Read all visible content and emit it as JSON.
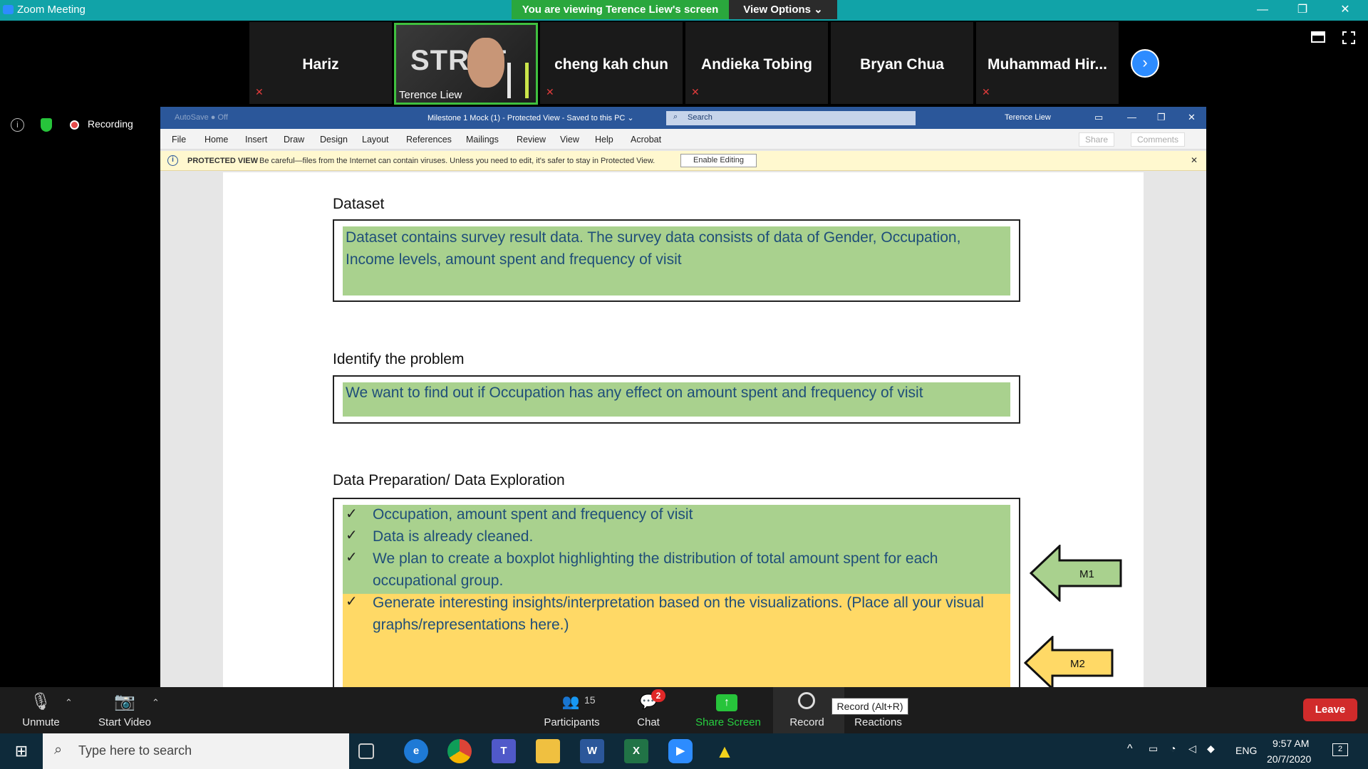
{
  "window": {
    "title": "Zoom Meeting"
  },
  "share_banner": {
    "viewing": "You are viewing Terence Liew's screen",
    "view_options": "View Options ⌄"
  },
  "window_buttons": {
    "minimize": "—",
    "restore": "❐",
    "close": "✕"
  },
  "gallery": {
    "participants": [
      {
        "name": "Hariz"
      },
      {
        "name": "Terence Liew",
        "video": true,
        "video_text": "STRAT"
      },
      {
        "name": "cheng kah chun"
      },
      {
        "name": "Andieka Tobing"
      },
      {
        "name": "Bryan Chua"
      },
      {
        "name": "Muhammad  Hir..."
      }
    ],
    "next_icon": "›",
    "muted_icon": "🎙"
  },
  "rail": {
    "info_icon": "i",
    "recording_label": "Recording"
  },
  "word": {
    "doc_title": "Milestone 1 Mock (1)  -  Protected View  -  Saved to this PC  ⌄",
    "quick_access": "AutoSave ● Off",
    "search_placeholder": "Search",
    "user": "Terence Liew",
    "tabs": [
      "File",
      "Home",
      "Insert",
      "Draw",
      "Design",
      "Layout",
      "References",
      "Mailings",
      "Review",
      "View",
      "Help",
      "Acrobat"
    ],
    "share_label": "Share",
    "comments_label": "Comments",
    "protected": {
      "label": "PROTECTED VIEW",
      "text": "Be careful—files from the Internet can contain viruses. Unless you need to edit, it's safer to stay in Protected View.",
      "button": "Enable Editing",
      "close": "✕"
    }
  },
  "document": {
    "dataset_heading": "Dataset",
    "dataset_text": "Dataset contains survey result data. The survey data consists of data of Gender, Occupation, Income levels, amount spent  and frequency of visit",
    "problem_heading": "Identify the problem",
    "problem_text": "We want to find out if Occupation has any effect on amount spent and frequency of visit",
    "prep_heading": "Data Preparation/ Data Exploration",
    "check_mark": "✓",
    "prep_items": [
      "Occupation, amount spent and frequency of visit",
      "Data is already cleaned.",
      "We plan to create a boxplot highlighting the distribution of total amount spent for each occupational group.",
      "Generate interesting insights/interpretation based on the visualizations. (Place all your visual graphs/representations here.)"
    ],
    "arrow_m1": "M1",
    "arrow_m2": "M2",
    "colors": {
      "green": "#a9d18e",
      "yellow": "#ffd966"
    }
  },
  "toolbar": {
    "unmute": "Unmute",
    "start_video": "Start Video",
    "participants": "Participants",
    "participants_count": "15",
    "chat": "Chat",
    "chat_badge": "2",
    "share_screen": "Share Screen",
    "record": "Record",
    "record_tooltip": "Record (Alt+R)",
    "reactions": "Reactions",
    "leave": "Leave",
    "caret": "⌃"
  },
  "taskbar": {
    "search_placeholder": "Type here to search",
    "apps": [
      "task-view",
      "edge",
      "chrome",
      "teams",
      "file-explorer",
      "word",
      "excel",
      "zoom",
      "other"
    ],
    "language": "ENG",
    "time": "9:57 AM",
    "date": "20/7/2020",
    "notifications": "2"
  }
}
